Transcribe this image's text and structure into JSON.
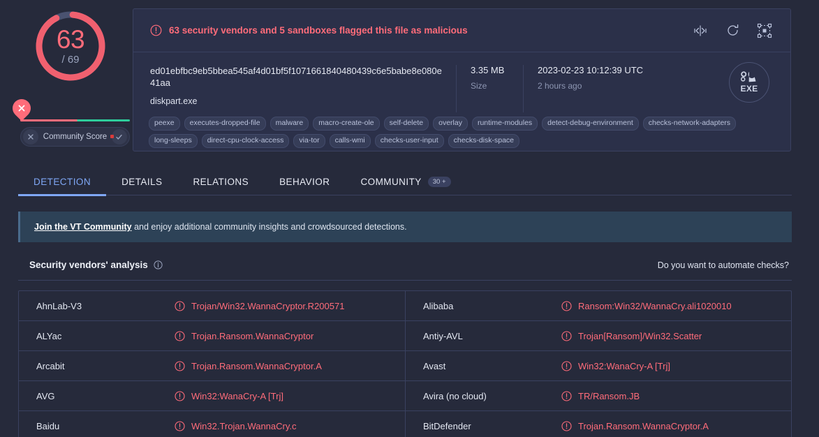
{
  "score": {
    "detected": "63",
    "total": "/ 69",
    "detected_n": 63,
    "total_n": 69,
    "ring_color": "#f0606f",
    "ring_track": "#4a5270"
  },
  "community_score": {
    "label": "Community Score",
    "negative_icon": "x-icon",
    "positive_icon": "check-icon",
    "pin_icon": "x-pin-icon",
    "bar_red_pct": 52
  },
  "alert": {
    "icon": "exclamation-circle-icon",
    "message": "63 security vendors and 5 sandboxes flagged this file as malicious",
    "color": "#ff6c7a",
    "actions": [
      {
        "name": "compare-icon",
        "title": "Compare"
      },
      {
        "name": "reanalyze-icon",
        "title": "Reanalyze"
      },
      {
        "name": "similar-icon",
        "title": "Similar"
      }
    ]
  },
  "file": {
    "hash": "ed01ebfbc9eb5bbea545af4d01bf5f1071661840480439c6e5babe8e080e41aa",
    "name": "diskpart.exe",
    "size": "3.35 MB",
    "size_label": "Size",
    "analysis_date": "2023-02-23 10:12:39 UTC",
    "analysis_relative": "2 hours ago",
    "type_badge": "EXE",
    "type_icon": "exe-gear-icon"
  },
  "tags": [
    "peexe",
    "executes-dropped-file",
    "malware",
    "macro-create-ole",
    "self-delete",
    "overlay",
    "runtime-modules",
    "detect-debug-environment",
    "checks-network-adapters",
    "long-sleeps",
    "direct-cpu-clock-access",
    "via-tor",
    "calls-wmi",
    "checks-user-input",
    "checks-disk-space"
  ],
  "tabs": [
    {
      "label": "DETECTION",
      "active": true,
      "badge": ""
    },
    {
      "label": "DETAILS",
      "active": false,
      "badge": ""
    },
    {
      "label": "RELATIONS",
      "active": false,
      "badge": ""
    },
    {
      "label": "BEHAVIOR",
      "active": false,
      "badge": ""
    },
    {
      "label": "COMMUNITY",
      "active": false,
      "badge": "30 +"
    }
  ],
  "join_banner": {
    "link": "Join the VT Community",
    "rest": " and enjoy additional community insights and crowdsourced detections."
  },
  "panel": {
    "title": "Security vendors' analysis",
    "info_icon": "info-circle-icon",
    "automate": "Do you want to automate checks?"
  },
  "vendors": [
    {
      "left": {
        "name": "AhnLab-V3",
        "result": "Trojan/Win32.WannaCryptor.R200571",
        "icon": "exclamation-circle-icon"
      },
      "right": {
        "name": "Alibaba",
        "result": "Ransom:Win32/WannaCry.ali1020010",
        "icon": "exclamation-circle-icon"
      }
    },
    {
      "left": {
        "name": "ALYac",
        "result": "Trojan.Ransom.WannaCryptor",
        "icon": "exclamation-circle-icon"
      },
      "right": {
        "name": "Antiy-AVL",
        "result": "Trojan[Ransom]/Win32.Scatter",
        "icon": "exclamation-circle-icon"
      }
    },
    {
      "left": {
        "name": "Arcabit",
        "result": "Trojan.Ransom.WannaCryptor.A",
        "icon": "exclamation-circle-icon"
      },
      "right": {
        "name": "Avast",
        "result": "Win32:WanaCry-A [Trj]",
        "icon": "exclamation-circle-icon"
      }
    },
    {
      "left": {
        "name": "AVG",
        "result": "Win32:WanaCry-A [Trj]",
        "icon": "exclamation-circle-icon"
      },
      "right": {
        "name": "Avira (no cloud)",
        "result": "TR/Ransom.JB",
        "icon": "exclamation-circle-icon"
      }
    },
    {
      "left": {
        "name": "Baidu",
        "result": "Win32.Trojan.WannaCry.c",
        "icon": "exclamation-circle-icon"
      },
      "right": {
        "name": "BitDefender",
        "result": "Trojan.Ransom.WannaCryptor.A",
        "icon": "exclamation-circle-icon"
      }
    }
  ]
}
